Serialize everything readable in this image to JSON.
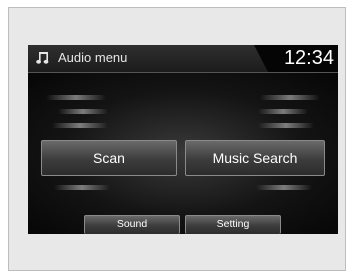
{
  "header": {
    "title": "Audio menu",
    "clock": "12:34",
    "icon": "music-note-icon"
  },
  "main_buttons": {
    "scan": "Scan",
    "music_search": "Music Search"
  },
  "bottom_buttons": {
    "sound": "Sound",
    "setting": "Setting"
  },
  "colors": {
    "screen_background": "#0e0e0e",
    "button_text": "#ffffff",
    "header_text": "#e6e6e6"
  }
}
